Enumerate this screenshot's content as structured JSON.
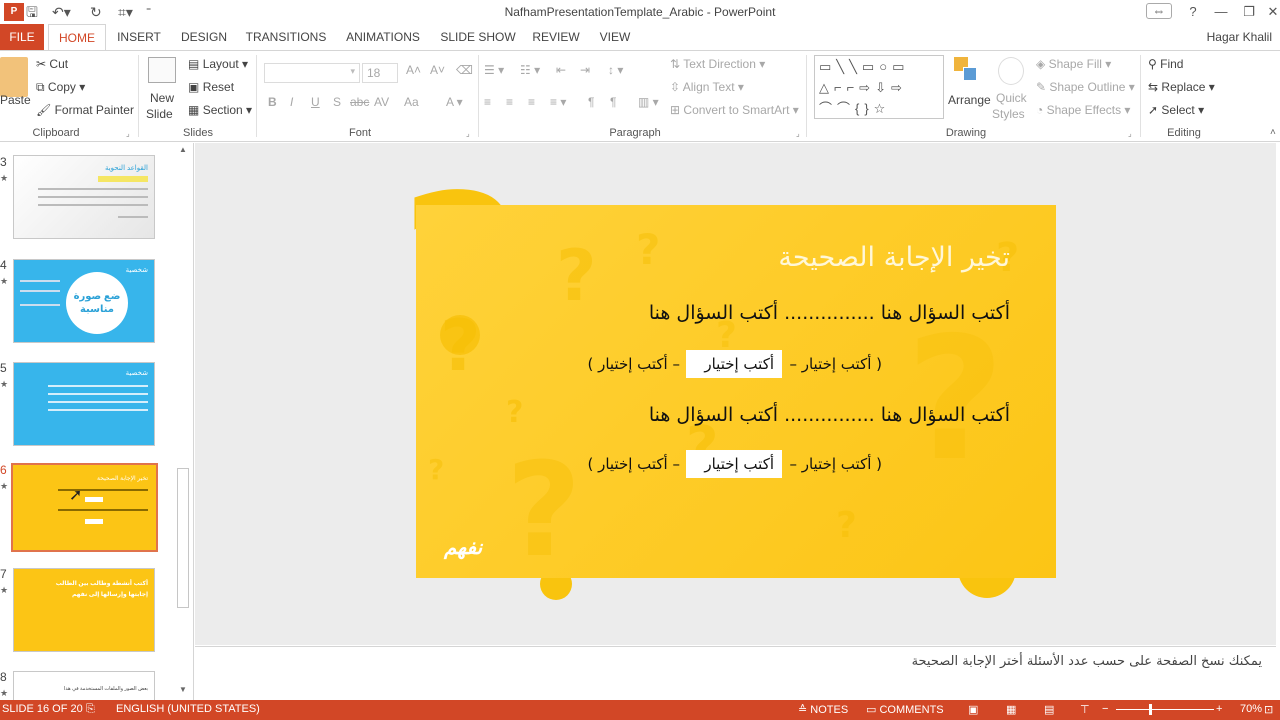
{
  "window": {
    "title": "NafhamPresentationTemplate_Arabic - PowerPoint",
    "user": "Hagar Khalil"
  },
  "tabs": [
    "FILE",
    "HOME",
    "INSERT",
    "DESIGN",
    "TRANSITIONS",
    "ANIMATIONS",
    "SLIDE SHOW",
    "REVIEW",
    "VIEW"
  ],
  "ribbon": {
    "clipboard": {
      "paste": "Paste",
      "cut": "Cut",
      "copy": "Copy",
      "format_painter": "Format Painter",
      "label": "Clipboard"
    },
    "slides": {
      "new_slide": "New",
      "new_slide2": "Slide",
      "layout": "Layout",
      "reset": "Reset",
      "section": "Section",
      "label": "Slides"
    },
    "font": {
      "size": "18",
      "bold": "B",
      "italic": "I",
      "underline": "U",
      "strike": "S",
      "shadow": "abc",
      "spacing": "AV",
      "case": "Aa",
      "label": "Font"
    },
    "paragraph": {
      "text_direction": "Text Direction",
      "align_text": "Align Text",
      "convert_smartart": "Convert to SmartArt",
      "label": "Paragraph"
    },
    "drawing": {
      "arrange": "Arrange",
      "quick_styles": "Quick",
      "quick_styles2": "Styles",
      "shape_fill": "Shape Fill",
      "shape_outline": "Shape Outline",
      "shape_effects": "Shape Effects",
      "label": "Drawing"
    },
    "editing": {
      "find": "Find",
      "replace": "Replace",
      "select": "Select",
      "label": "Editing"
    }
  },
  "thumbnails": [
    {
      "num": "3",
      "title": "القواعد النحوية"
    },
    {
      "num": "4",
      "title": "شخصية",
      "center": "ضع صورة مناسبة"
    },
    {
      "num": "5",
      "title": "شخصية"
    },
    {
      "num": "6",
      "title": "تخير الإجابة الصحيحة"
    },
    {
      "num": "7",
      "title": "أكتب أنشطة وطالب بين الطالب إجابتها وإرسالها إلى نفهم"
    },
    {
      "num": "8",
      "title": "بعض الصور والملفات المستخدمة في هذا"
    }
  ],
  "slide": {
    "title": "تخير الإجابة الصحيحة",
    "q1": "أكتب السؤال هنا ............... أكتب السؤال هنا",
    "choices1_left": "( أكتب إختيار –",
    "choices1_mid": "أكتب إختيار",
    "choices1_right": "– أكتب إختيار )",
    "q2": "أكتب السؤال هنا ............... أكتب السؤال هنا",
    "choices2_left": "( أكتب إختيار –",
    "choices2_mid": "أكتب إختيار",
    "choices2_right": "– أكتب إختيار )",
    "logo": "نفهم"
  },
  "notes": {
    "text": "يمكنك نسخ الصفحة على حسب عدد الأسئلة  أختر الإجابة الصحيحة"
  },
  "status": {
    "slide_info": "SLIDE 16 OF 20",
    "language": "ENGLISH (UNITED STATES)",
    "notes": "NOTES",
    "comments": "COMMENTS",
    "zoom": "70%"
  },
  "colors": {
    "accent": "#d24726",
    "slide_bg": "#fcc515",
    "shape": "#f6bf05"
  }
}
